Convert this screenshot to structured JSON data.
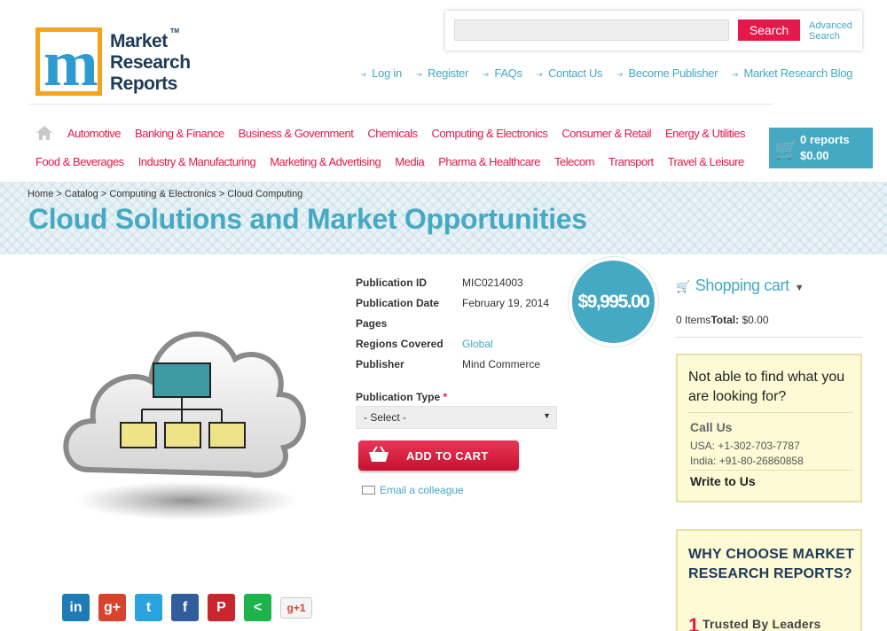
{
  "logo": {
    "line1": "Market",
    "line2": "Research",
    "line3": "Reports",
    "tm": "TM"
  },
  "search": {
    "button": "Search",
    "advanced": "Advanced Search"
  },
  "top_links": [
    "Log in",
    "Register",
    "FAQs",
    "Contact Us",
    "Become Publisher",
    "Market Research Blog"
  ],
  "categories_row1": [
    "Automotive",
    "Banking & Finance",
    "Business & Government",
    "Chemicals",
    "Computing & Electronics",
    "Consumer & Retail",
    "Energy & Utilities"
  ],
  "categories_row2": [
    "Food & Beverages",
    "Industry & Manufacturing",
    "Marketing & Advertising",
    "Media",
    "Pharma & Healthcare",
    "Telecom",
    "Transport",
    "Travel & Leisure"
  ],
  "cart_summary": {
    "reports": "0 reports",
    "total": "$0.00"
  },
  "breadcrumb": "Home > Catalog > Computing & Electronics > Cloud Computing",
  "title": "Cloud Solutions and Market Opportunities",
  "details": [
    {
      "label": "Publication ID",
      "value": "MIC0214003"
    },
    {
      "label": "Publication Date",
      "value": "February 19, 2014"
    },
    {
      "label": "Pages",
      "value": ""
    },
    {
      "label": "Regions Covered",
      "value": "Global"
    },
    {
      "label": "Publisher",
      "value": "Mind Commerce"
    }
  ],
  "price": "$9,995.00",
  "pub_type": {
    "label": "Publication Type",
    "required": "*",
    "selected": "- Select -"
  },
  "add_to_cart": "ADD TO CART",
  "email_colleague": "Email a colleague",
  "shopping_cart": {
    "title": "Shopping cart",
    "items": "0 Items",
    "total_label": "Total:",
    "total": "$0.00"
  },
  "help": {
    "question": "Not able to find what you are looking for?",
    "call_us": "Call Us",
    "usa": "USA: +1-302-703-7787",
    "india": "India: +91-80-26860858",
    "write_us": "Write to Us"
  },
  "why": {
    "title": "WHY CHOOSE MARKET RESEARCH REPORTS?",
    "num": "1",
    "item": "Trusted By Leaders"
  },
  "social": {
    "linkedin": "in",
    "gplus": "g+",
    "twitter": "t",
    "facebook": "f",
    "pinterest": "P",
    "share": "<",
    "gplusone": "g+1"
  },
  "colors": {
    "accent": "#45a9c3",
    "brand_red": "#e4184a",
    "logo_blue": "#1d3a57",
    "help_bg": "#fdfad5"
  }
}
